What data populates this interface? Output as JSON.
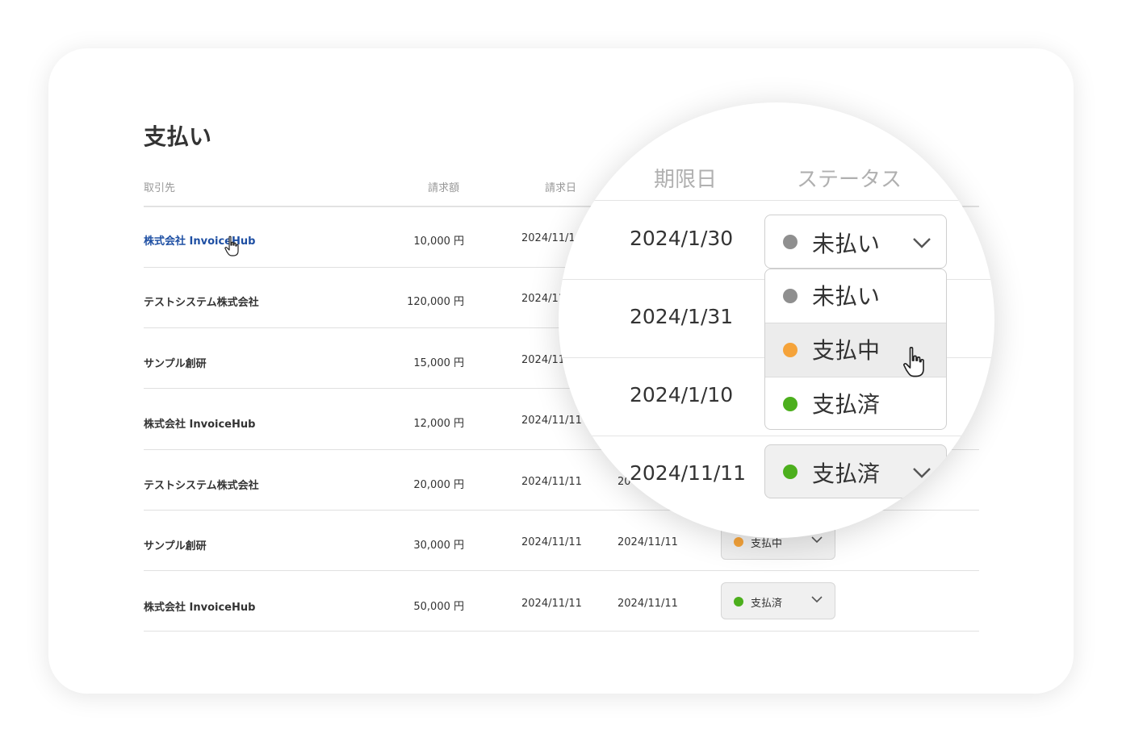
{
  "page": {
    "title": "支払い"
  },
  "columns": {
    "partner": "取引先",
    "amount": "請求額",
    "invoice_date": "請求日",
    "due_date": "期限日",
    "status": "ステータス"
  },
  "colors": {
    "unpaid": "#8f8f8f",
    "in_progress": "#f5a33a",
    "paid": "#4caf1d",
    "link": "#1e4fa3"
  },
  "rows": [
    {
      "partner": "株式会社 InvoiceHub",
      "amount": "10,000 円",
      "invoice_date": "2024/11/1"
    },
    {
      "partner": "テストシステム株式会社",
      "amount": "120,000 円",
      "invoice_date": "2024/11"
    },
    {
      "partner": "サンプル創研",
      "amount": "15,000 円",
      "invoice_date": "2024/11"
    },
    {
      "partner": "株式会社 InvoiceHub",
      "amount": "12,000 円",
      "invoice_date": "2024/11/11"
    },
    {
      "partner": "テストシステム株式会社",
      "amount": "20,000 円",
      "invoice_date": "2024/11/11",
      "due_date_fragment": "20"
    },
    {
      "partner": "サンプル創研",
      "amount": "30,000 円",
      "invoice_date": "2024/11/11",
      "due_date": "2024/11/11",
      "status": "支払中"
    },
    {
      "partner": "株式会社 InvoiceHub",
      "amount": "50,000 円",
      "invoice_date": "2024/11/11",
      "due_date": "2024/11/11",
      "status": "支払済"
    }
  ],
  "magnifier": {
    "headers": {
      "due_date": "期限日",
      "status": "ステータス"
    },
    "dates": [
      "2024/1/30",
      "2024/1/31",
      "2024/1/10",
      "2024/11/11"
    ],
    "select_top": {
      "status": "未払い",
      "icon": "chevron-down-icon"
    },
    "dropdown_options": [
      "未払い",
      "支払中",
      "支払済"
    ],
    "hovered_option": "支払中",
    "select_bottom": {
      "status": "支払済",
      "icon": "chevron-down-icon"
    }
  }
}
